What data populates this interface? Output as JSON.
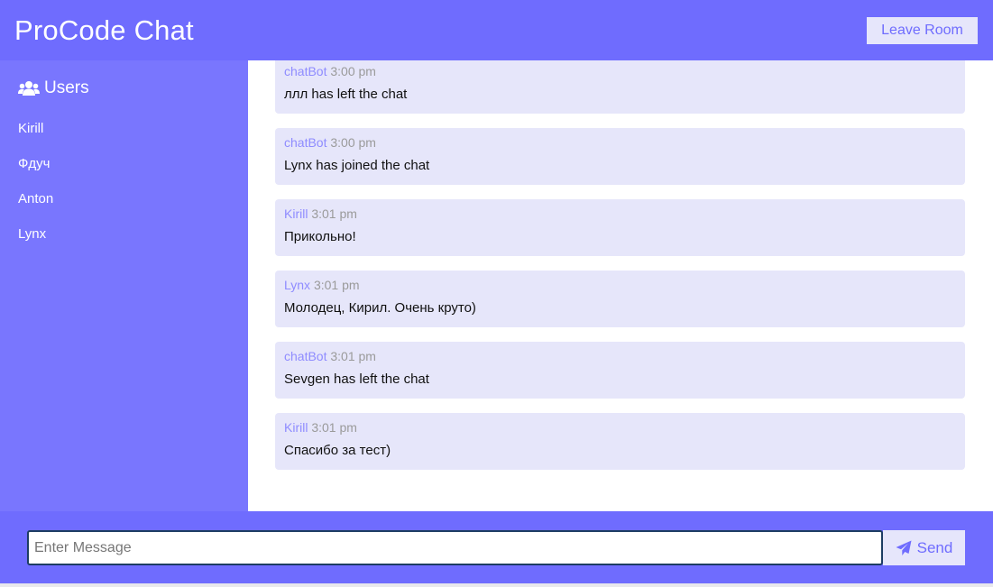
{
  "header": {
    "title": "ProCode Chat",
    "leave_label": "Leave Room"
  },
  "sidebar": {
    "heading": "Users",
    "heading_icon": "users-icon",
    "users": [
      "Kirill",
      "Фдуч",
      "Anton",
      "Lynx"
    ]
  },
  "messages": [
    {
      "author": "chatBot",
      "time": "3:00 pm",
      "text": "ллл has left the chat"
    },
    {
      "author": "chatBot",
      "time": "3:00 pm",
      "text": "Lynx has joined the chat"
    },
    {
      "author": "Kirill",
      "time": "3:01 pm",
      "text": "Прикольно!"
    },
    {
      "author": "Lynx",
      "time": "3:01 pm",
      "text": "Молодец, Кирил. Очень круто)"
    },
    {
      "author": "chatBot",
      "time": "3:01 pm",
      "text": "Sevgen has left the chat"
    },
    {
      "author": "Kirill",
      "time": "3:01 pm",
      "text": "Спасибо за тест)"
    }
  ],
  "composer": {
    "placeholder": "Enter Message",
    "value": "",
    "send_label": "Send",
    "send_icon": "paper-plane-icon"
  },
  "colors": {
    "primary": "#6f6cfe",
    "sidebar": "#7976fe",
    "message_bg": "#e6e6fa",
    "author": "#8f8cff"
  }
}
